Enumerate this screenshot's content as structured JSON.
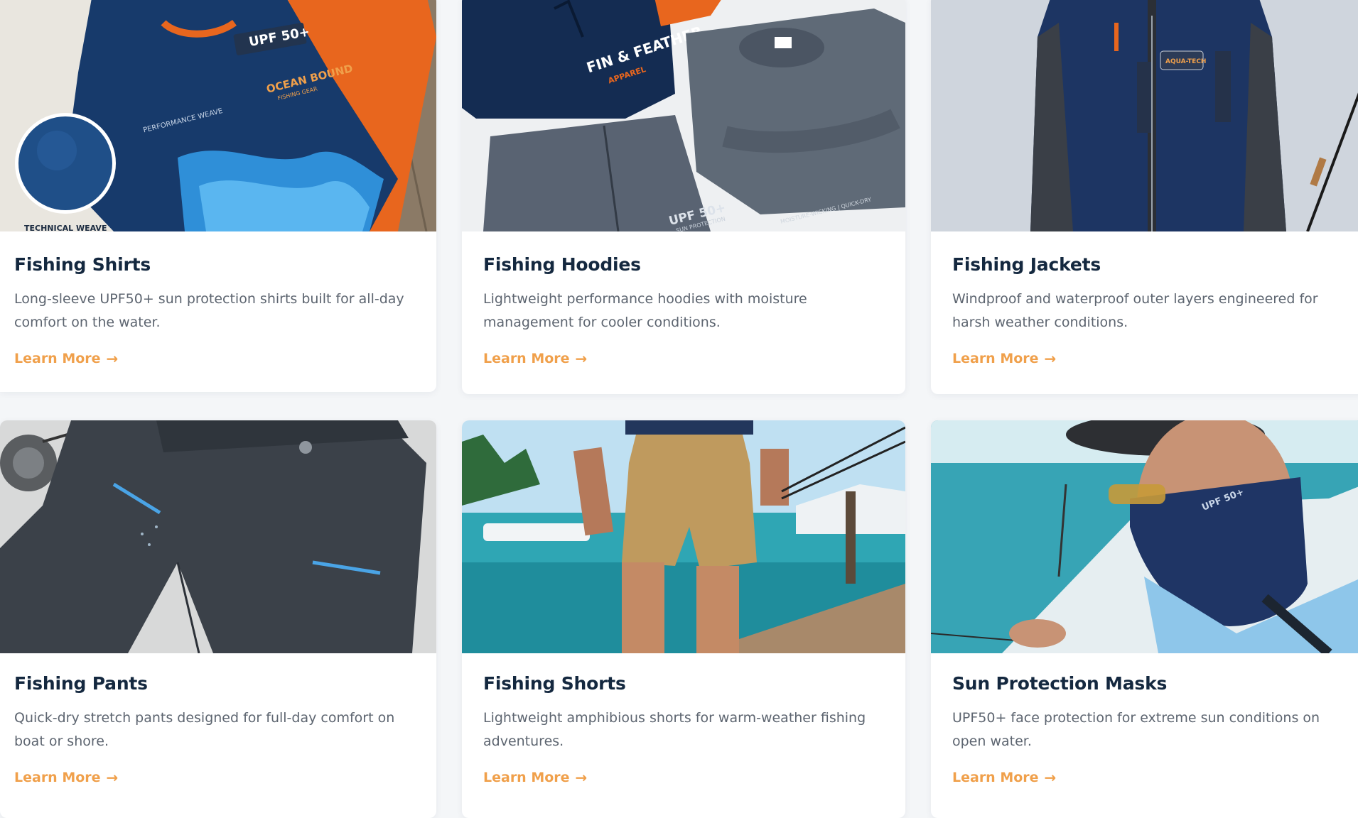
{
  "cards": [
    {
      "title": "Fishing Shirts",
      "description": "Long-sleeve UPF50+ sun protection shirts built for all-day comfort on the water.",
      "cta": "Learn More",
      "image_text": {
        "tag": "UPF 50+",
        "brand_top": "OCEAN BOUND",
        "brand_sub": "FISHING GEAR",
        "weave": "PERFORMANCE WEAVE",
        "badge": "TECHNICAL WEAVE"
      }
    },
    {
      "title": "Fishing Hoodies",
      "description": "Lightweight performance hoodies with moisture management for cooler conditions.",
      "cta": "Learn More",
      "image_text": {
        "brand_top": "FIN & FEATHER",
        "brand_sub": "APPAREL",
        "upf": "UPF 50+",
        "upf_sub": "SUN PROTECTION",
        "sleeve": "MOISTURE-WICKING | QUICK-DRY"
      }
    },
    {
      "title": "Fishing Jackets",
      "description": "Windproof and waterproof outer layers engineered for harsh weather conditions.",
      "cta": "Learn More",
      "image_text": {
        "badge": "AQUA-TECH"
      }
    },
    {
      "title": "Fishing Pants",
      "description": "Quick-dry stretch pants designed for full-day comfort on boat or shore.",
      "cta": "Learn More",
      "image_text": {}
    },
    {
      "title": "Fishing Shorts",
      "description": "Lightweight amphibious shorts for warm-weather fishing adventures.",
      "cta": "Learn More",
      "image_text": {}
    },
    {
      "title": "Sun Protection Masks",
      "description": "UPF50+ face protection for extreme sun conditions on open water.",
      "cta": "Learn More",
      "image_text": {
        "mask": "UPF 50+"
      }
    }
  ],
  "icons": {
    "cta_arrow": "arrow-right-icon"
  },
  "colors": {
    "title": "#14283f",
    "text": "#5d6570",
    "accent": "#f0a04b",
    "background": "#f4f6f8",
    "card": "#ffffff"
  }
}
